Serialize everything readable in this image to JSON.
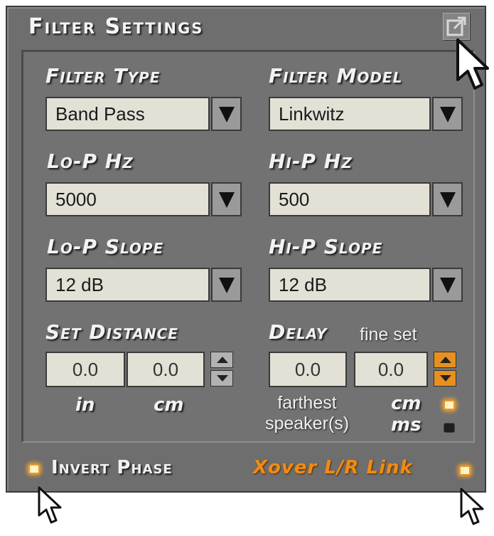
{
  "panel": {
    "title": "Filter Settings"
  },
  "filter_type": {
    "label": "Filter Type",
    "value": "Band Pass"
  },
  "filter_model": {
    "label": "Filter Model",
    "value": "Linkwitz"
  },
  "lo_p_hz": {
    "label": "Lo-P  Hz",
    "value": "5000"
  },
  "hi_p_hz": {
    "label": "Hi-P  Hz",
    "value": "500"
  },
  "lo_p_slope": {
    "label": "Lo-P Slope",
    "value": "12 dB"
  },
  "hi_p_slope": {
    "label": "Hi-P Slope",
    "value": "12 dB"
  },
  "set_distance": {
    "label": "Set Distance",
    "in_value": "0.0",
    "cm_value": "0.0",
    "in_unit": "in",
    "cm_unit": "cm"
  },
  "delay": {
    "label": "Delay",
    "fine_set_label": "fine set",
    "value": "0.0",
    "fine_value": "0.0",
    "farthest_line1": "farthest",
    "farthest_line2": "speaker(s)",
    "unit_cm": "cm",
    "unit_ms": "ms",
    "unit_cm_selected": true,
    "unit_ms_selected": false
  },
  "invert_phase": {
    "label": "Invert Phase",
    "checked": true
  },
  "xover_link": {
    "label": "Xover L/R Link",
    "checked": true
  },
  "colors": {
    "panel": "#6e6e6e",
    "field": "#e3e0d6",
    "accent": "#e8901e",
    "text": "#f2f2f2"
  },
  "icons": [
    "popout-icon",
    "dropdown-arrow-icon",
    "stepper-up-icon",
    "stepper-down-icon",
    "mouse-cursor-icon"
  ]
}
